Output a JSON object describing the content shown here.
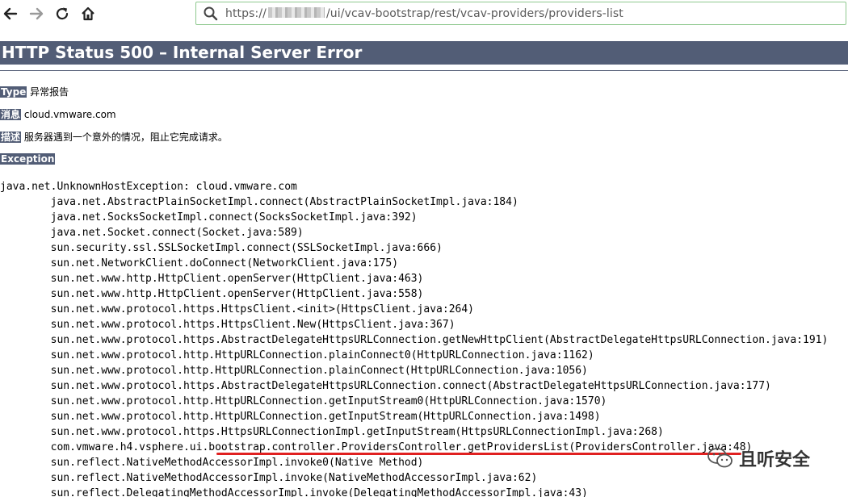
{
  "browser": {
    "url_prefix": "https://",
    "url_suffix": "/ui/vcav-bootstrap/rest/vcav-providers/providers-list"
  },
  "error_page": {
    "title": "HTTP Status 500 – Internal Server Error",
    "type_label": "Type",
    "type_value": "异常报告",
    "message_label": "消息",
    "message_value": "cloud.vmware.com",
    "description_label": "描述",
    "description_value": "服务器遇到一个意外的情况，阻止它完成请求。",
    "exception_label": "Exception",
    "stack_trace": [
      "java.net.UnknownHostException: cloud.vmware.com",
      "\tjava.net.AbstractPlainSocketImpl.connect(AbstractPlainSocketImpl.java:184)",
      "\tjava.net.SocksSocketImpl.connect(SocksSocketImpl.java:392)",
      "\tjava.net.Socket.connect(Socket.java:589)",
      "\tsun.security.ssl.SSLSocketImpl.connect(SSLSocketImpl.java:666)",
      "\tsun.net.NetworkClient.doConnect(NetworkClient.java:175)",
      "\tsun.net.www.http.HttpClient.openServer(HttpClient.java:463)",
      "\tsun.net.www.http.HttpClient.openServer(HttpClient.java:558)",
      "\tsun.net.www.protocol.https.HttpsClient.<init>(HttpsClient.java:264)",
      "\tsun.net.www.protocol.https.HttpsClient.New(HttpsClient.java:367)",
      "\tsun.net.www.protocol.https.AbstractDelegateHttpsURLConnection.getNewHttpClient(AbstractDelegateHttpsURLConnection.java:191)",
      "\tsun.net.www.protocol.http.HttpURLConnection.plainConnect0(HttpURLConnection.java:1162)",
      "\tsun.net.www.protocol.http.HttpURLConnection.plainConnect(HttpURLConnection.java:1056)",
      "\tsun.net.www.protocol.https.AbstractDelegateHttpsURLConnection.connect(AbstractDelegateHttpsURLConnection.java:177)",
      "\tsun.net.www.protocol.http.HttpURLConnection.getInputStream0(HttpURLConnection.java:1570)",
      "\tsun.net.www.protocol.http.HttpURLConnection.getInputStream(HttpURLConnection.java:1498)",
      "\tsun.net.www.protocol.https.HttpsURLConnectionImpl.getInputStream(HttpsURLConnectionImpl.java:268)",
      "\tcom.vmware.h4.vsphere.ui.bootstrap.controller.ProvidersController.getProvidersList(ProvidersController.java:48)",
      "\tsun.reflect.NativeMethodAccessorImpl.invoke0(Native Method)",
      "\tsun.reflect.NativeMethodAccessorImpl.invoke(NativeMethodAccessorImpl.java:62)",
      "\tsun.reflect.DelegatingMethodAccessorImpl.invoke(DelegatingMethodAccessorImpl.java:43)"
    ]
  },
  "watermark": {
    "text": "且听安全"
  },
  "colors": {
    "header_bg": "#525d76",
    "highlight_line": "#e02020",
    "url_border": "#8fc98f"
  }
}
